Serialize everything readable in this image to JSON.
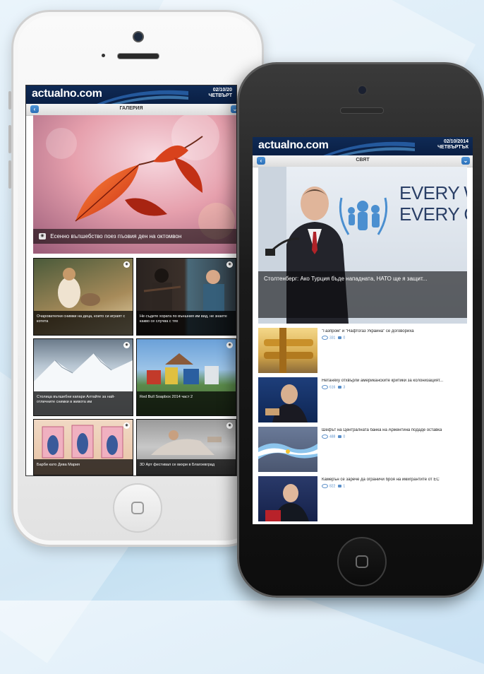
{
  "brand": {
    "logo_text": "actualno.com",
    "header_bg": "#0c2349",
    "accent": "#3a83cc"
  },
  "left_phone": {
    "date": "02/10/20",
    "weekday": "ЧЕТВЪРТ",
    "section_title": "ГАЛЕРИЯ",
    "back_icon": "chevron-left-icon",
    "menu_icon": "chevron-down-icon",
    "hero": {
      "caption": "Есенно вълшебство поез пъовия ден на октомвон",
      "icon": "camera-icon"
    },
    "gallery": [
      {
        "caption": "Очарователни снимки на деца, които си играят с котета"
      },
      {
        "caption": "Не съдете хората по външния им вид, не знаете какво се случва с тях"
      },
      {
        "caption": "Столица вълшебни капари Алтайте за най-отличните снимки в живота им"
      },
      {
        "caption": "Red Bull Soapbox 2014 част 2"
      },
      {
        "caption": "Барби като Дева Мария"
      },
      {
        "caption": "3D Арт фестивал се вихри в Благоевград"
      }
    ]
  },
  "right_phone": {
    "date": "02/10/2014",
    "weekday": "ЧЕТВЪРТЪК",
    "section_title": "СВЯТ",
    "back_icon": "chevron-left-icon",
    "menu_icon": "chevron-down-icon",
    "hero": {
      "caption": "Столтенберг: Ако Турция бъде нападната, НАТО ще я защит...",
      "backdrop_text_1": "EVERY W",
      "backdrop_text_2": "EVERY C"
    },
    "news": [
      {
        "title": "\"Газпром\" и \"Нафтогаз Украйна\" се договориха",
        "views": "331",
        "comments": "0"
      },
      {
        "title": "Нетаняху отхвърли американските критики за колонизацият...",
        "views": "616",
        "comments": "3"
      },
      {
        "title": "Шефът на Централната банка на Аржентина подаде оставка",
        "views": "488",
        "comments": "0"
      },
      {
        "title": "Камерън се зарече да ограничи броя на имигрантите от ЕС",
        "views": "822",
        "comments": "1"
      }
    ]
  }
}
